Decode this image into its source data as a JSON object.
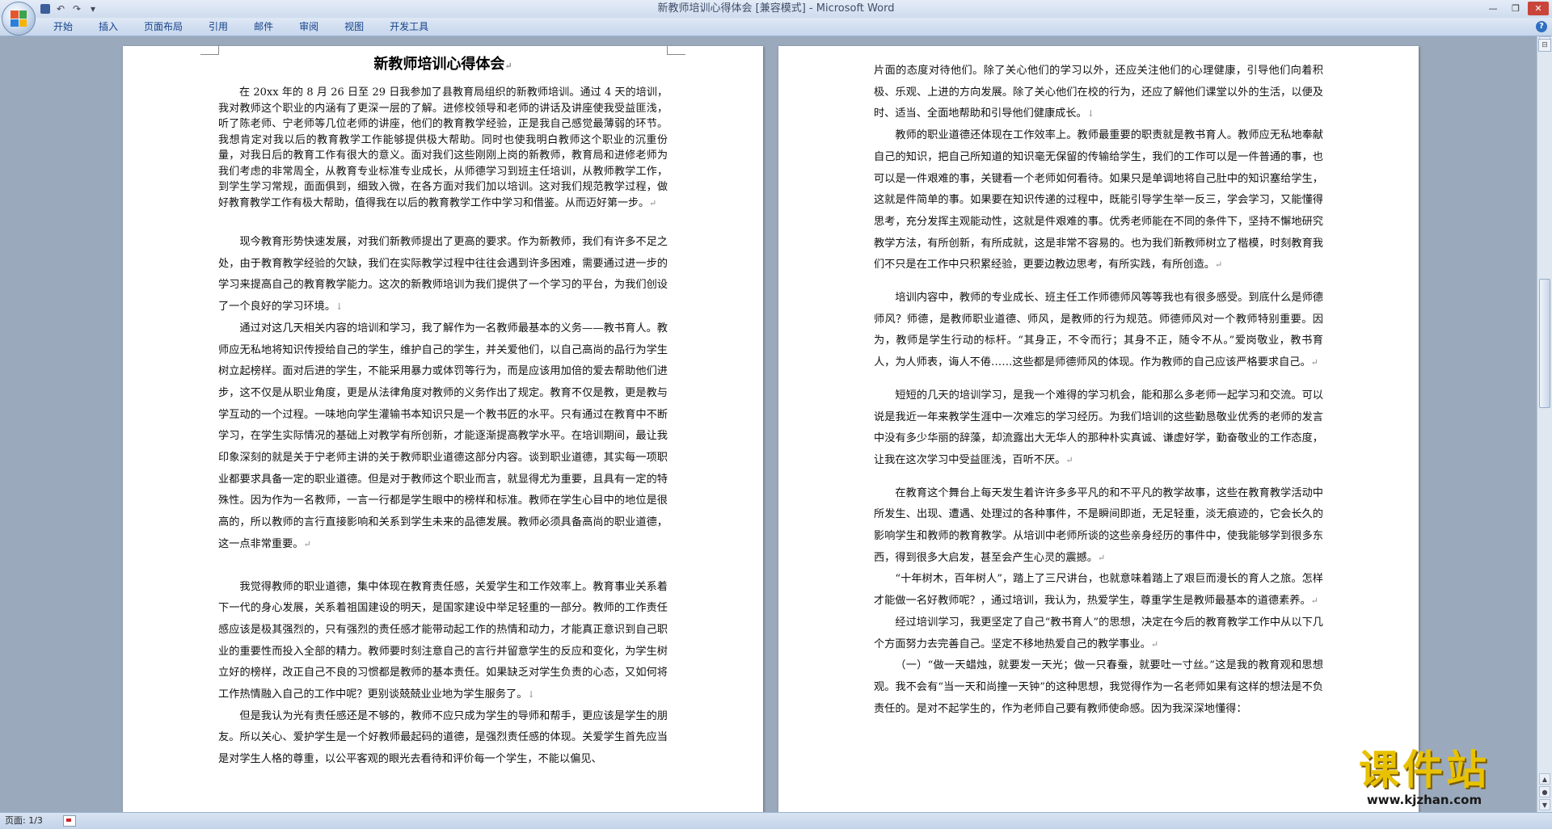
{
  "window": {
    "title": "新教师培训心得体会 [兼容模式] - Microsoft Word"
  },
  "qat": {
    "save": "save-icon",
    "undo": "↶",
    "redo": "↷",
    "customize": "▾"
  },
  "ribbon": {
    "tabs": [
      "开始",
      "插入",
      "页面布局",
      "引用",
      "邮件",
      "审阅",
      "视图",
      "开发工具"
    ],
    "help": "?"
  },
  "document": {
    "title": "新教师培训心得体会",
    "left_page": [
      "在 20xx 年的 8 月 26 日至 29 日我参加了县教育局组织的新教师培训。通过 4 天的培训，我对教师这个职业的内涵有了更深一层的了解。进修校领导和老师的讲话及讲座使我受益匪浅，听了陈老师、宁老师等几位老师的讲座，他们的教育教学经验，正是我自己感觉最薄弱的环节。我想肯定对我以后的教育教学工作能够提供极大帮助。同时也使我明白教师这个职业的沉重份量，对我日后的教育工作有很大的意义。面对我们这些刚刚上岗的新教师，教育局和进修老师为我们考虑的非常周全，从教育专业标准专业成长，从师德学习到班主任培训，从教师教学工作，到学生学习常规，面面俱到，细致入微，在各方面对我们加以培训。这对我们规范教学过程，做好教育教学工作有极大帮助，值得我在以后的教育教学工作中学习和借鉴。从而迈好第一步。",
      "现今教育形势快速发展，对我们新教师提出了更高的要求。作为新教师，我们有许多不足之处，由于教育教学经验的欠缺，我们在实际教学过程中往往会遇到许多困难，需要通过进一步的学习来提高自己的教育教学能力。这次的新教师培训为我们提供了一个学习的平台，为我们创设了一个良好的学习环境。",
      "通过对这几天相关内容的培训和学习，我了解作为一名教师最基本的义务——教书育人。教师应无私地将知识传授给自己的学生，维护自己的学生，并关爱他们，以自己高尚的品行为学生树立起榜样。面对后进的学生，不能采用暴力或体罚等行为，而是应该用加倍的爱去帮助他们进步，这不仅是从职业角度，更是从法律角度对教师的义务作出了规定。教育不仅是教，更是教与学互动的一个过程。一味地向学生灌输书本知识只是一个教书匠的水平。只有通过在教育中不断学习，在学生实际情况的基础上对教学有所创新，才能逐渐提高教学水平。在培训期间，最让我印象深刻的就是关于宁老师主讲的关于教师职业道德这部分内容。谈到职业道德，其实每一项职业都要求具备一定的职业道德。但是对于教师这个职业而言，就显得尤为重要，且具有一定的特殊性。因为作为一名教师，一言一行都是学生眼中的榜样和标准。教师在学生心目中的地位是很高的，所以教师的言行直接影响和关系到学生未来的品德发展。教师必须具备高尚的职业道德，这一点非常重要。",
      "我觉得教师的职业道德，集中体现在教育责任感，关爱学生和工作效率上。教育事业关系着下一代的身心发展，关系着祖国建设的明天，是国家建设中举足轻重的一部分。教师的工作责任感应该是极其强烈的，只有强烈的责任感才能带动起工作的热情和动力，才能真正意识到自己职业的重要性而投入全部的精力。教师要时刻注意自己的言行并留意学生的反应和变化，为学生树立好的榜样，改正自己不良的习惯都是教师的基本责任。如果缺乏对学生负责的心态，又如何将工作热情融入自己的工作中呢？更别谈兢兢业业地为学生服务了。",
      "但是我认为光有责任感还是不够的，教师不应只成为学生的导师和帮手，更应该是学生的朋友。所以关心、爱护学生是一个好教师最起码的道德，是强烈责任感的体现。关爱学生首先应当是对学生人格的尊重，以公平客观的眼光去看待和评价每一个学生，不能以偏见、"
    ],
    "right_page": [
      "片面的态度对待他们。除了关心他们的学习以外，还应关注他们的心理健康，引导他们向着积极、乐观、上进的方向发展。除了关心他们在校的行为，还应了解他们课堂以外的生活，以便及时、适当、全面地帮助和引导他们健康成长。",
      "教师的职业道德还体现在工作效率上。教师最重要的职责就是教书育人。教师应无私地奉献自己的知识，把自己所知道的知识毫无保留的传输给学生，我们的工作可以是一件普通的事，也可以是一件艰难的事，关键看一个老师如何看待。如果只是单调地将自己肚中的知识塞给学生，这就是件简单的事。如果要在知识传递的过程中，既能引导学生举一反三，学会学习，又能懂得思考，充分发挥主观能动性，这就是件艰难的事。优秀老师能在不同的条件下，坚持不懈地研究教学方法，有所创新，有所成就，这是非常不容易的。也为我们新教师树立了楷模，时刻教育我们不只是在工作中只积累经验，更要边教边思考，有所实践，有所创造。",
      "培训内容中，教师的专业成长、班主任工作师德师风等等我也有很多感受。到底什么是师德师风？师德，是教师职业道德、师风，是教师的行为规范。师德师风对一个教师特别重要。因为，教师是学生行动的标杆。“其身正，不令而行；其身不正，随令不从。”爱岗敬业，教书育人，为人师表，诲人不倦……这些都是师德师风的体现。作为教师的自己应该严格要求自己。",
      "短短的几天的培训学习，是我一个难得的学习机会，能和那么多老师一起学习和交流。可以说是我近一年来教学生涯中一次难忘的学习经历。为我们培训的这些勤恳敬业优秀的老师的发言中没有多少华丽的辞藻，却流露出大无华人的那种朴实真诚、谦虚好学，勤奋敬业的工作态度，让我在这次学习中受益匪浅，百听不厌。",
      "在教育这个舞台上每天发生着许许多多平凡的和不平凡的教学故事，这些在教育教学活动中所发生、出现、遭遇、处理过的各种事件，不是瞬间即逝，无足轻重，淡无痕迹的，它会长久的影响学生和教师的教育教学。从培训中老师所谈的这些亲身经历的事件中，使我能够学到很多东西，得到很多大启发，甚至会产生心灵的震撼。",
      "“十年树木，百年树人”，踏上了三尺讲台，也就意味着踏上了艰巨而漫长的育人之旅。怎样才能做一名好教师呢？，通过培训，我认为，热爱学生，尊重学生是教师最基本的道德素养。",
      "经过培训学习，我更坚定了自己“教书育人”的思想，决定在今后的教育教学工作中从以下几个方面努力去完善自己。坚定不移地热爱自己的教学事业。",
      "（一）“做一天蜡烛，就要发一天光；做一只春蚕，就要吐一寸丝。”这是我的教育观和思想观。我不会有“当一天和尚撞一天钟”的这种思想，我觉得作为一名老师如果有这样的想法是不负责任的。是对不起学生的，作为老师自己要有教师使命感。因为我深深地懂得："
    ]
  },
  "statusbar": {
    "page": "页面: 1/3"
  },
  "watermark": {
    "cn": "课件站",
    "url": "www.kjzhan.com"
  }
}
